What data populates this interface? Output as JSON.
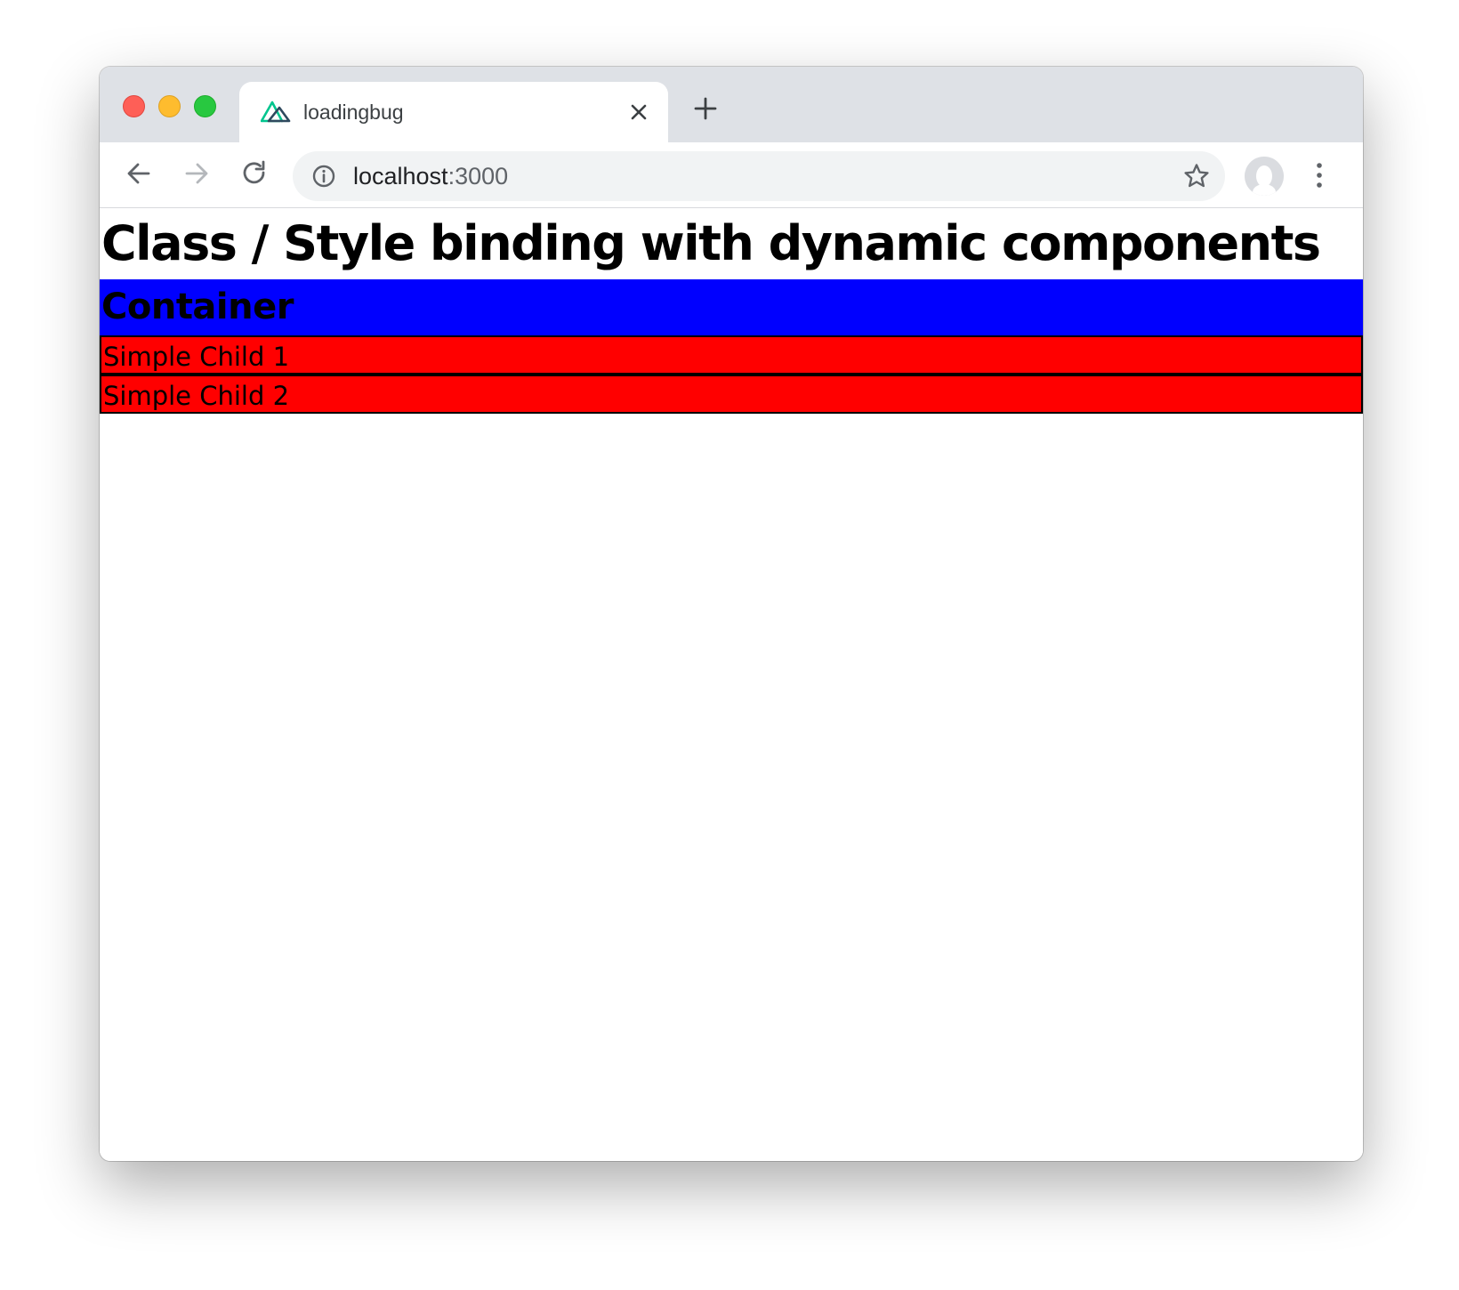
{
  "browser": {
    "tab": {
      "title": "loadingbug",
      "favicon": "nuxt-logo-icon"
    },
    "address_bar": {
      "host": "localhost",
      "port": ":3000"
    },
    "icons": {
      "back": "back-arrow-icon",
      "forward": "forward-arrow-icon",
      "reload": "reload-icon",
      "info": "info-icon",
      "star": "star-icon",
      "menu": "kebab-menu-icon",
      "close": "close-icon",
      "new_tab": "plus-icon"
    }
  },
  "page": {
    "heading": "Class / Style binding with dynamic components",
    "container": {
      "heading": "Container",
      "background": "#0000ff",
      "children": [
        {
          "label": "Simple Child 1",
          "background": "#ff0000"
        },
        {
          "label": "Simple Child 2",
          "background": "#ff0000"
        }
      ]
    }
  }
}
